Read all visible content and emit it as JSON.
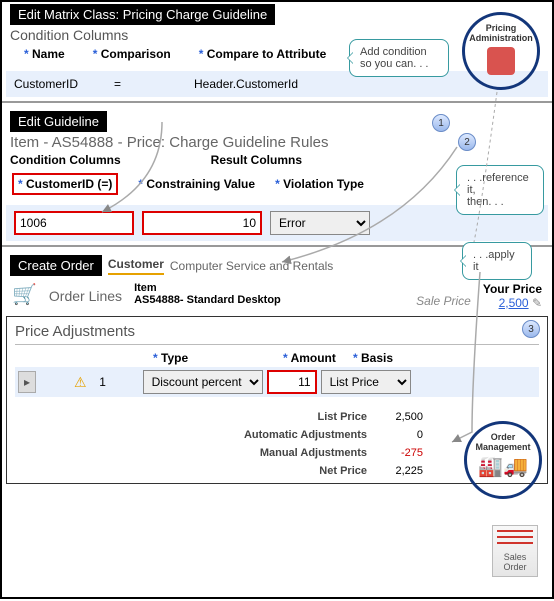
{
  "matrix": {
    "title": "Edit Matrix Class: Pricing Charge Guideline",
    "subtitle": "Condition Columns",
    "headers": {
      "name": "Name",
      "comparison": "Comparison",
      "compare_to": "Compare to Attribute"
    },
    "row": {
      "name": "CustomerID",
      "comparison": "=",
      "compare_to": "Header.CustomerId"
    }
  },
  "guideline": {
    "tab": "Edit Guideline",
    "title": "Item - AS54888 - Price: Charge Guideline Rules",
    "cond_hdr": "Condition Columns",
    "result_hdr": "Result Columns",
    "cols": {
      "customer": "CustomerID (=)",
      "constraining": "Constraining Value",
      "violation": "Violation Type"
    },
    "row": {
      "customer": "1006",
      "constraining": "10",
      "violation": "Error"
    }
  },
  "order": {
    "tab": "Create Order",
    "customer_lbl": "Customer",
    "customer_val": "Computer Service and Rentals",
    "lines_lbl": "Order Lines",
    "item_lbl": "Item",
    "item_val": "AS54888- Standard Desktop",
    "sale_price": "Sale Price",
    "your_price_lbl": "Your Price",
    "your_price": "2,500",
    "adj_title": "Price Adjustments",
    "adj_cols": {
      "type": "Type",
      "amount": "Amount",
      "basis": "Basis"
    },
    "adj_row": {
      "num": "1",
      "type": "Discount percent",
      "amount": "11",
      "basis": "List Price"
    },
    "totals": {
      "list": {
        "lbl": "List Price",
        "val": "2,500"
      },
      "auto": {
        "lbl": "Automatic Adjustments",
        "val": "0"
      },
      "manual": {
        "lbl": "Manual Adjustments",
        "val": "-275"
      },
      "net": {
        "lbl": "Net Price",
        "val": "2,225"
      }
    }
  },
  "callouts": {
    "c1": "Add condition\nso you can. . .",
    "c2": ". . .reference  it,\nthen. . .",
    "c3": ". . .apply it"
  },
  "rings": {
    "pricing": "Pricing\nAdministration",
    "om": "Order\nManagement"
  },
  "sticky": "Sales\nOrder",
  "steps": {
    "s1": "1",
    "s2": "2",
    "s3": "3"
  }
}
